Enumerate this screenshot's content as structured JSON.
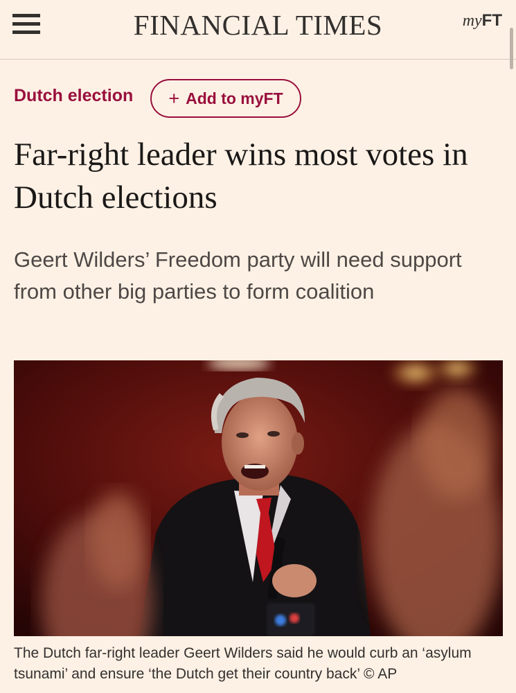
{
  "header": {
    "masthead": "FINANCIAL TIMES",
    "myft_prefix": "my",
    "myft_suffix": "FT",
    "menu_icon": "hamburger-menu-icon"
  },
  "article": {
    "topic": "Dutch election",
    "add_to_myft_label": "Add to myFT",
    "add_icon": "plus-icon",
    "headline": "Far-right leader wins most votes in Dutch elections",
    "standfirst": "Geert Wilders’ Freedom party will need support from other big parties to form coalition",
    "caption": "The Dutch far-right leader Geert Wilders said he would curb an ‘asylum tsunami’ and ensure ‘the Dutch get their country back’ © AP"
  },
  "colors": {
    "background": "#fdf1e5",
    "accent": "#990f3d",
    "text": "#33302e"
  }
}
